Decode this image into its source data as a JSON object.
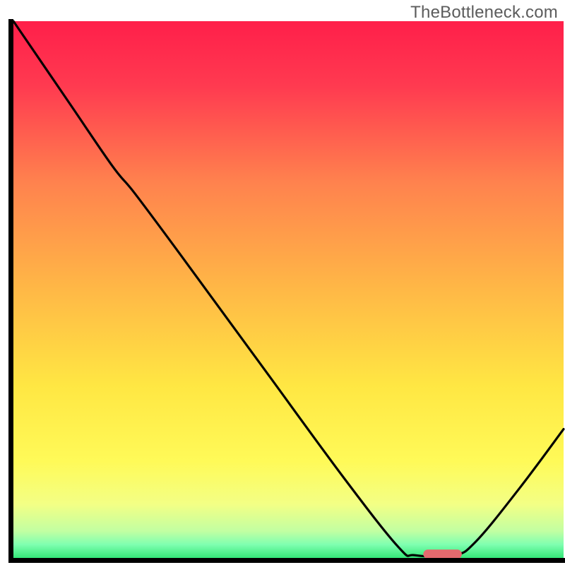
{
  "watermark": "TheBottleneck.com",
  "chart_data": {
    "type": "line",
    "title": "",
    "xlabel": "",
    "ylabel": "",
    "xlim": [
      0,
      100
    ],
    "ylim": [
      0,
      100
    ],
    "grid": false,
    "legend": false,
    "annotations": [],
    "background": {
      "type": "vertical-gradient",
      "stops": [
        {
          "pos": 0.0,
          "color": "#ff1f4a"
        },
        {
          "pos": 0.12,
          "color": "#ff3a50"
        },
        {
          "pos": 0.3,
          "color": "#ff824e"
        },
        {
          "pos": 0.5,
          "color": "#ffb846"
        },
        {
          "pos": 0.68,
          "color": "#ffe743"
        },
        {
          "pos": 0.82,
          "color": "#fffa58"
        },
        {
          "pos": 0.9,
          "color": "#f3ff85"
        },
        {
          "pos": 0.95,
          "color": "#c2ffa2"
        },
        {
          "pos": 0.975,
          "color": "#7fffb0"
        },
        {
          "pos": 1.0,
          "color": "#34e778"
        }
      ]
    },
    "series": [
      {
        "name": "bottleneck-curve",
        "color": "#000000",
        "points": [
          {
            "x": 0.0,
            "y": 100.0
          },
          {
            "x": 10.0,
            "y": 85.0
          },
          {
            "x": 18.0,
            "y": 73.0
          },
          {
            "x": 22.0,
            "y": 68.0
          },
          {
            "x": 30.0,
            "y": 57.0
          },
          {
            "x": 45.0,
            "y": 36.0
          },
          {
            "x": 60.0,
            "y": 15.0
          },
          {
            "x": 70.0,
            "y": 2.0
          },
          {
            "x": 73.0,
            "y": 0.5
          },
          {
            "x": 80.0,
            "y": 0.5
          },
          {
            "x": 84.0,
            "y": 3.0
          },
          {
            "x": 92.0,
            "y": 13.0
          },
          {
            "x": 100.0,
            "y": 24.0
          }
        ]
      }
    ],
    "markers": [
      {
        "name": "optimal-marker",
        "shape": "capsule",
        "x_center": 78.0,
        "y": 0.7,
        "width_x": 7.0,
        "color": "#e46a6e"
      }
    ]
  }
}
